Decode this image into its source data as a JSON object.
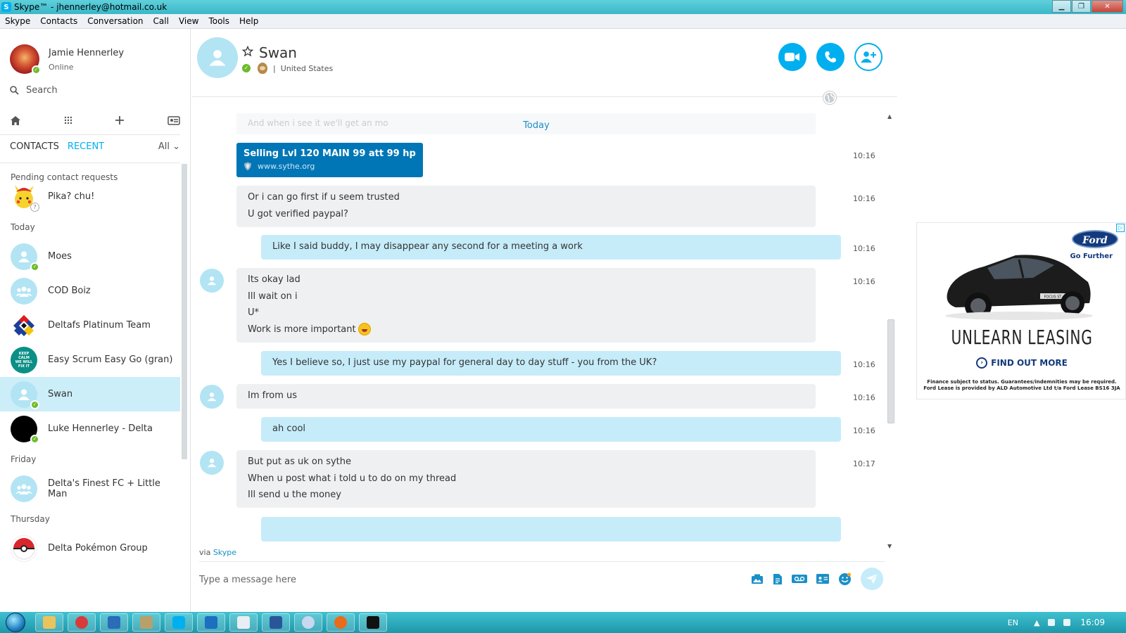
{
  "window": {
    "title": "Skype™ - jhennerley@hotmail.co.uk"
  },
  "menu": [
    "Skype",
    "Contacts",
    "Conversation",
    "Call",
    "View",
    "Tools",
    "Help"
  ],
  "profile": {
    "name": "Jamie Hennerley",
    "status": "Online"
  },
  "search": {
    "label": "Search"
  },
  "tabs": {
    "contacts": "CONTACTS",
    "recent": "RECENT",
    "filter": "All"
  },
  "sections": {
    "pending": "Pending contact requests",
    "today": "Today",
    "friday": "Friday",
    "thursday": "Thursday"
  },
  "contacts": {
    "pika": "Pika? chu!",
    "moes": "Moes",
    "cod": "COD Boiz",
    "deltafs": "Deltafs Platinum Team",
    "scrum": "Easy Scrum Easy Go (gran)",
    "swan": "Swan",
    "luke": "Luke Hennerley - Delta",
    "finest": "Delta's Finest FC + Little Man",
    "pokemon": "Delta Pokémon Group"
  },
  "conversation": {
    "name": "Swan",
    "location": "United States",
    "ghost_text": "And when i see it we'll get an mo",
    "day_label": "Today",
    "link": {
      "title": "Selling Lvl 120 MAIN 99 att 99 hp 94...",
      "url": "www.sythe.org",
      "time": "10:16"
    },
    "messages": [
      {
        "dir": "in",
        "lines": [
          "Or i can go first if u seem trusted",
          "U got verified paypal?"
        ],
        "time": "10:16"
      },
      {
        "dir": "out",
        "lines": [
          "Like I said buddy, I may disappear any second for a meeting a work"
        ],
        "time": "10:16"
      },
      {
        "dir": "in",
        "lines": [
          "Its okay lad",
          "Ill wait on i",
          "U*",
          "Work is more important"
        ],
        "time": "10:16"
      },
      {
        "dir": "out",
        "lines": [
          "Yes I believe so, I just use my paypal for general day to day stuff - you from the UK?"
        ],
        "time": "10:16"
      },
      {
        "dir": "in",
        "lines": [
          "Im from us"
        ],
        "time": "10:16"
      },
      {
        "dir": "out",
        "lines": [
          "ah cool"
        ],
        "time": "10:16"
      },
      {
        "dir": "in",
        "lines": [
          "But put as uk on sythe",
          "When u post what i told u to do on my thread",
          "Ill send u the money"
        ],
        "time": "10:17"
      }
    ],
    "via_prefix": "via",
    "via_link": "Skype",
    "input_placeholder": "Type a message here"
  },
  "ad": {
    "brand": "Ford",
    "tagline": "Go Further",
    "badge": "FOCUS ST",
    "headline": "UNLEARN LEASING",
    "cta": "FIND OUT MORE",
    "fine_print_1": "Finance subject to status. Guarantees/indemnities may be required.",
    "fine_print_2": "Ford Lease is provided by ALD Automotive Ltd t/a Ford Lease BS16 3JA"
  },
  "taskbar": {
    "lang": "EN",
    "clock": "16:09"
  },
  "colors": {
    "accent": "#00aff0",
    "online": "#6cbb2a",
    "outgoing": "#c6ecfa",
    "incoming": "#eef0f2",
    "link_card": "#0076b6"
  }
}
